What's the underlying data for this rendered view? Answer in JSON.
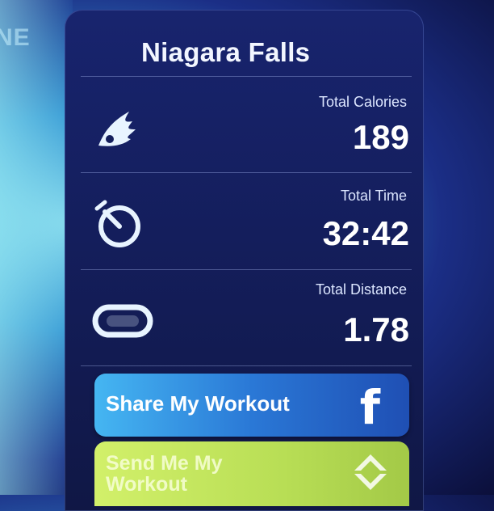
{
  "bezel": {
    "text": "NE"
  },
  "workout": {
    "title": "Niagara Falls",
    "stats": [
      {
        "label": "Total Calories",
        "value": "189",
        "icon": "wing-icon"
      },
      {
        "label": "Total Time",
        "value": "32:42",
        "icon": "stopwatch-icon"
      },
      {
        "label": "Total Distance",
        "value": "1.78",
        "icon": "track-icon"
      }
    ]
  },
  "actions": {
    "share_label": "Share My Workout",
    "share_icon": "facebook-icon",
    "send_label": "Send Me My Workout",
    "send_icon": "sync-icon"
  },
  "colors": {
    "panel": "#141e5c",
    "share_button": "#2a78d6",
    "send_button": "#c4e35e"
  }
}
